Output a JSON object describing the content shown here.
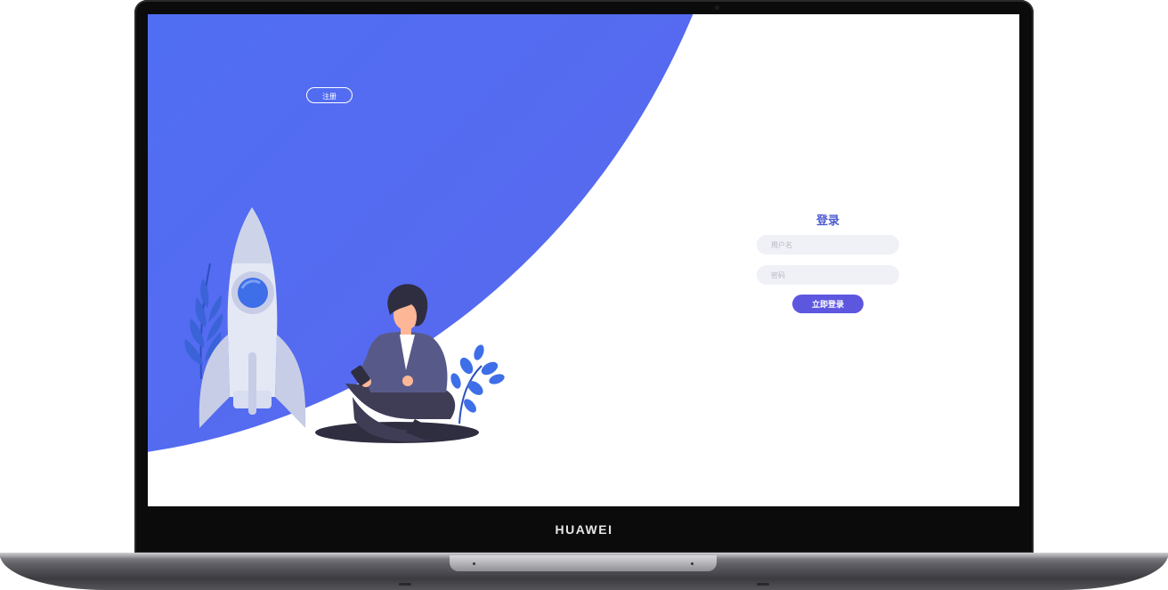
{
  "laptop": {
    "brand": "HUAWEI"
  },
  "page": {
    "register_label": "注册",
    "login": {
      "title": "登录",
      "username_placeholder": "用户名",
      "password_placeholder": "密码",
      "submit_label": "立即登录"
    }
  },
  "colors": {
    "panel_blue": "#4f6ff2",
    "title": "#4d5bd1",
    "button": "#5d57e0",
    "input_bg": "#f0f0f7"
  },
  "illustration": {
    "items": [
      "rocket",
      "plant",
      "person-with-phone"
    ]
  }
}
